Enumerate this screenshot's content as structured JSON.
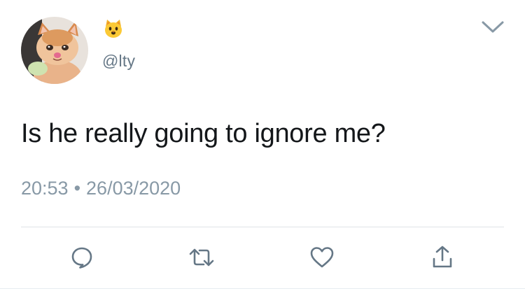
{
  "author": {
    "display_name_emoji": "🐱",
    "display_name_icon": "cat-face-emoji",
    "handle": "@lty",
    "avatar": "crying-cat-photo"
  },
  "tweet": {
    "text": "Is he really going to ignore me?",
    "time": "20:53",
    "separator": "•",
    "date": "26/03/2020"
  },
  "actions": [
    {
      "name": "reply",
      "icon": "speech-bubble-icon"
    },
    {
      "name": "retweet",
      "icon": "retweet-icon"
    },
    {
      "name": "like",
      "icon": "heart-icon"
    },
    {
      "name": "share",
      "icon": "share-icon"
    }
  ],
  "colors": {
    "icon": "#657786",
    "secondary_text": "#8899a6",
    "primary_text": "#14171a"
  }
}
